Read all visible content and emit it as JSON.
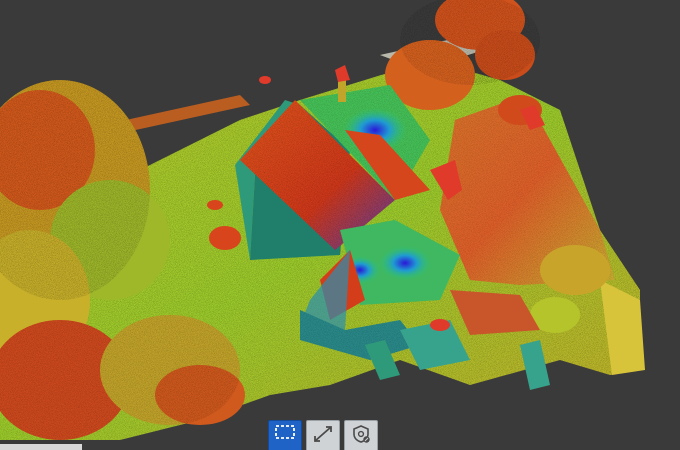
{
  "viewer": {
    "background": "#3a3a3a"
  },
  "toolbar": {
    "buttons": [
      {
        "name": "select-region",
        "icon": "dashed-rectangle-icon",
        "label": "",
        "active": true
      },
      {
        "name": "measure-distance",
        "icon": "diagonal-measure-icon",
        "label": "",
        "active": false
      },
      {
        "name": "settings",
        "icon": "shield-gear-icon",
        "label": "",
        "active": false
      }
    ],
    "active_color": "#1f63c6",
    "inactive_color": "#cfd3d6"
  },
  "colormap": {
    "low": "#1a2fd6",
    "mid_low": "#22c7a8",
    "mid": "#7ed321",
    "mid_high": "#e7d21a",
    "high": "#e0391a"
  }
}
